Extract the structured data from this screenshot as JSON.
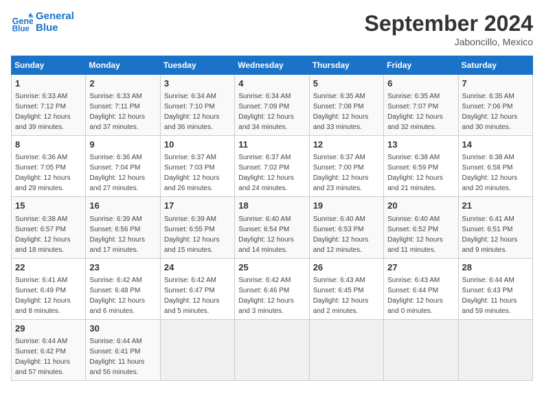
{
  "header": {
    "logo_line1": "General",
    "logo_line2": "Blue",
    "month": "September 2024",
    "location": "Jaboncillo, Mexico"
  },
  "days_of_week": [
    "Sunday",
    "Monday",
    "Tuesday",
    "Wednesday",
    "Thursday",
    "Friday",
    "Saturday"
  ],
  "weeks": [
    [
      {
        "day": "1",
        "sunrise": "6:33 AM",
        "sunset": "7:12 PM",
        "daylight": "12 hours and 39 minutes."
      },
      {
        "day": "2",
        "sunrise": "6:33 AM",
        "sunset": "7:11 PM",
        "daylight": "12 hours and 37 minutes."
      },
      {
        "day": "3",
        "sunrise": "6:34 AM",
        "sunset": "7:10 PM",
        "daylight": "12 hours and 36 minutes."
      },
      {
        "day": "4",
        "sunrise": "6:34 AM",
        "sunset": "7:09 PM",
        "daylight": "12 hours and 34 minutes."
      },
      {
        "day": "5",
        "sunrise": "6:35 AM",
        "sunset": "7:08 PM",
        "daylight": "12 hours and 33 minutes."
      },
      {
        "day": "6",
        "sunrise": "6:35 AM",
        "sunset": "7:07 PM",
        "daylight": "12 hours and 32 minutes."
      },
      {
        "day": "7",
        "sunrise": "6:35 AM",
        "sunset": "7:06 PM",
        "daylight": "12 hours and 30 minutes."
      }
    ],
    [
      {
        "day": "8",
        "sunrise": "6:36 AM",
        "sunset": "7:05 PM",
        "daylight": "12 hours and 29 minutes."
      },
      {
        "day": "9",
        "sunrise": "6:36 AM",
        "sunset": "7:04 PM",
        "daylight": "12 hours and 27 minutes."
      },
      {
        "day": "10",
        "sunrise": "6:37 AM",
        "sunset": "7:03 PM",
        "daylight": "12 hours and 26 minutes."
      },
      {
        "day": "11",
        "sunrise": "6:37 AM",
        "sunset": "7:02 PM",
        "daylight": "12 hours and 24 minutes."
      },
      {
        "day": "12",
        "sunrise": "6:37 AM",
        "sunset": "7:00 PM",
        "daylight": "12 hours and 23 minutes."
      },
      {
        "day": "13",
        "sunrise": "6:38 AM",
        "sunset": "6:59 PM",
        "daylight": "12 hours and 21 minutes."
      },
      {
        "day": "14",
        "sunrise": "6:38 AM",
        "sunset": "6:58 PM",
        "daylight": "12 hours and 20 minutes."
      }
    ],
    [
      {
        "day": "15",
        "sunrise": "6:38 AM",
        "sunset": "6:57 PM",
        "daylight": "12 hours and 18 minutes."
      },
      {
        "day": "16",
        "sunrise": "6:39 AM",
        "sunset": "6:56 PM",
        "daylight": "12 hours and 17 minutes."
      },
      {
        "day": "17",
        "sunrise": "6:39 AM",
        "sunset": "6:55 PM",
        "daylight": "12 hours and 15 minutes."
      },
      {
        "day": "18",
        "sunrise": "6:40 AM",
        "sunset": "6:54 PM",
        "daylight": "12 hours and 14 minutes."
      },
      {
        "day": "19",
        "sunrise": "6:40 AM",
        "sunset": "6:53 PM",
        "daylight": "12 hours and 12 minutes."
      },
      {
        "day": "20",
        "sunrise": "6:40 AM",
        "sunset": "6:52 PM",
        "daylight": "12 hours and 11 minutes."
      },
      {
        "day": "21",
        "sunrise": "6:41 AM",
        "sunset": "6:51 PM",
        "daylight": "12 hours and 9 minutes."
      }
    ],
    [
      {
        "day": "22",
        "sunrise": "6:41 AM",
        "sunset": "6:49 PM",
        "daylight": "12 hours and 8 minutes."
      },
      {
        "day": "23",
        "sunrise": "6:42 AM",
        "sunset": "6:48 PM",
        "daylight": "12 hours and 6 minutes."
      },
      {
        "day": "24",
        "sunrise": "6:42 AM",
        "sunset": "6:47 PM",
        "daylight": "12 hours and 5 minutes."
      },
      {
        "day": "25",
        "sunrise": "6:42 AM",
        "sunset": "6:46 PM",
        "daylight": "12 hours and 3 minutes."
      },
      {
        "day": "26",
        "sunrise": "6:43 AM",
        "sunset": "6:45 PM",
        "daylight": "12 hours and 2 minutes."
      },
      {
        "day": "27",
        "sunrise": "6:43 AM",
        "sunset": "6:44 PM",
        "daylight": "12 hours and 0 minutes."
      },
      {
        "day": "28",
        "sunrise": "6:44 AM",
        "sunset": "6:43 PM",
        "daylight": "11 hours and 59 minutes."
      }
    ],
    [
      {
        "day": "29",
        "sunrise": "6:44 AM",
        "sunset": "6:42 PM",
        "daylight": "11 hours and 57 minutes."
      },
      {
        "day": "30",
        "sunrise": "6:44 AM",
        "sunset": "6:41 PM",
        "daylight": "11 hours and 56 minutes."
      },
      null,
      null,
      null,
      null,
      null
    ]
  ],
  "labels": {
    "sunrise": "Sunrise:",
    "sunset": "Sunset:",
    "daylight": "Daylight:"
  }
}
